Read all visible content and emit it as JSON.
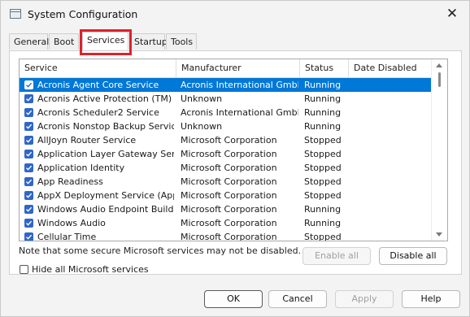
{
  "window": {
    "title": "System Configuration",
    "close_icon": "close-icon"
  },
  "tabs": [
    {
      "label": "General",
      "active": false
    },
    {
      "label": "Boot",
      "active": false
    },
    {
      "label": "Services",
      "active": true
    },
    {
      "label": "Startup",
      "active": false
    },
    {
      "label": "Tools",
      "active": false
    }
  ],
  "table": {
    "columns": [
      "Service",
      "Manufacturer",
      "Status",
      "Date Disabled"
    ],
    "rows": [
      {
        "service": "Acronis Agent Core Service",
        "manufacturer": "Acronis International GmbH",
        "status": "Running",
        "date_disabled": "",
        "checked": true,
        "selected": true
      },
      {
        "service": "Acronis Active Protection (TM) S...",
        "manufacturer": "Unknown",
        "status": "Running",
        "date_disabled": "",
        "checked": true,
        "selected": false
      },
      {
        "service": "Acronis Scheduler2 Service",
        "manufacturer": "Acronis International GmbH",
        "status": "Running",
        "date_disabled": "",
        "checked": true,
        "selected": false
      },
      {
        "service": "Acronis Nonstop Backup Service",
        "manufacturer": "Unknown",
        "status": "Running",
        "date_disabled": "",
        "checked": true,
        "selected": false
      },
      {
        "service": "AllJoyn Router Service",
        "manufacturer": "Microsoft Corporation",
        "status": "Stopped",
        "date_disabled": "",
        "checked": true,
        "selected": false
      },
      {
        "service": "Application Layer Gateway Service",
        "manufacturer": "Microsoft Corporation",
        "status": "Stopped",
        "date_disabled": "",
        "checked": true,
        "selected": false
      },
      {
        "service": "Application Identity",
        "manufacturer": "Microsoft Corporation",
        "status": "Stopped",
        "date_disabled": "",
        "checked": true,
        "selected": false
      },
      {
        "service": "App Readiness",
        "manufacturer": "Microsoft Corporation",
        "status": "Stopped",
        "date_disabled": "",
        "checked": true,
        "selected": false
      },
      {
        "service": "AppX Deployment Service (AppX...",
        "manufacturer": "Microsoft Corporation",
        "status": "Stopped",
        "date_disabled": "",
        "checked": true,
        "selected": false
      },
      {
        "service": "Windows Audio Endpoint Builder",
        "manufacturer": "Microsoft Corporation",
        "status": "Running",
        "date_disabled": "",
        "checked": true,
        "selected": false
      },
      {
        "service": "Windows Audio",
        "manufacturer": "Microsoft Corporation",
        "status": "Running",
        "date_disabled": "",
        "checked": true,
        "selected": false
      },
      {
        "service": "Cellular Time",
        "manufacturer": "Microsoft Corporation",
        "status": "Stopped",
        "date_disabled": "",
        "checked": true,
        "selected": false
      }
    ]
  },
  "note": "Note that some secure Microsoft services may not be disabled.",
  "buttons": {
    "enable_all": "Enable all",
    "disable_all": "Disable all",
    "ok": "OK",
    "cancel": "Cancel",
    "apply": "Apply",
    "help": "Help"
  },
  "hide_ms": {
    "label": "Hide all Microsoft services",
    "checked": false
  },
  "colors": {
    "selection": "#0078d7",
    "checkbox": "#2f66c9",
    "highlight": "#e0212a"
  }
}
